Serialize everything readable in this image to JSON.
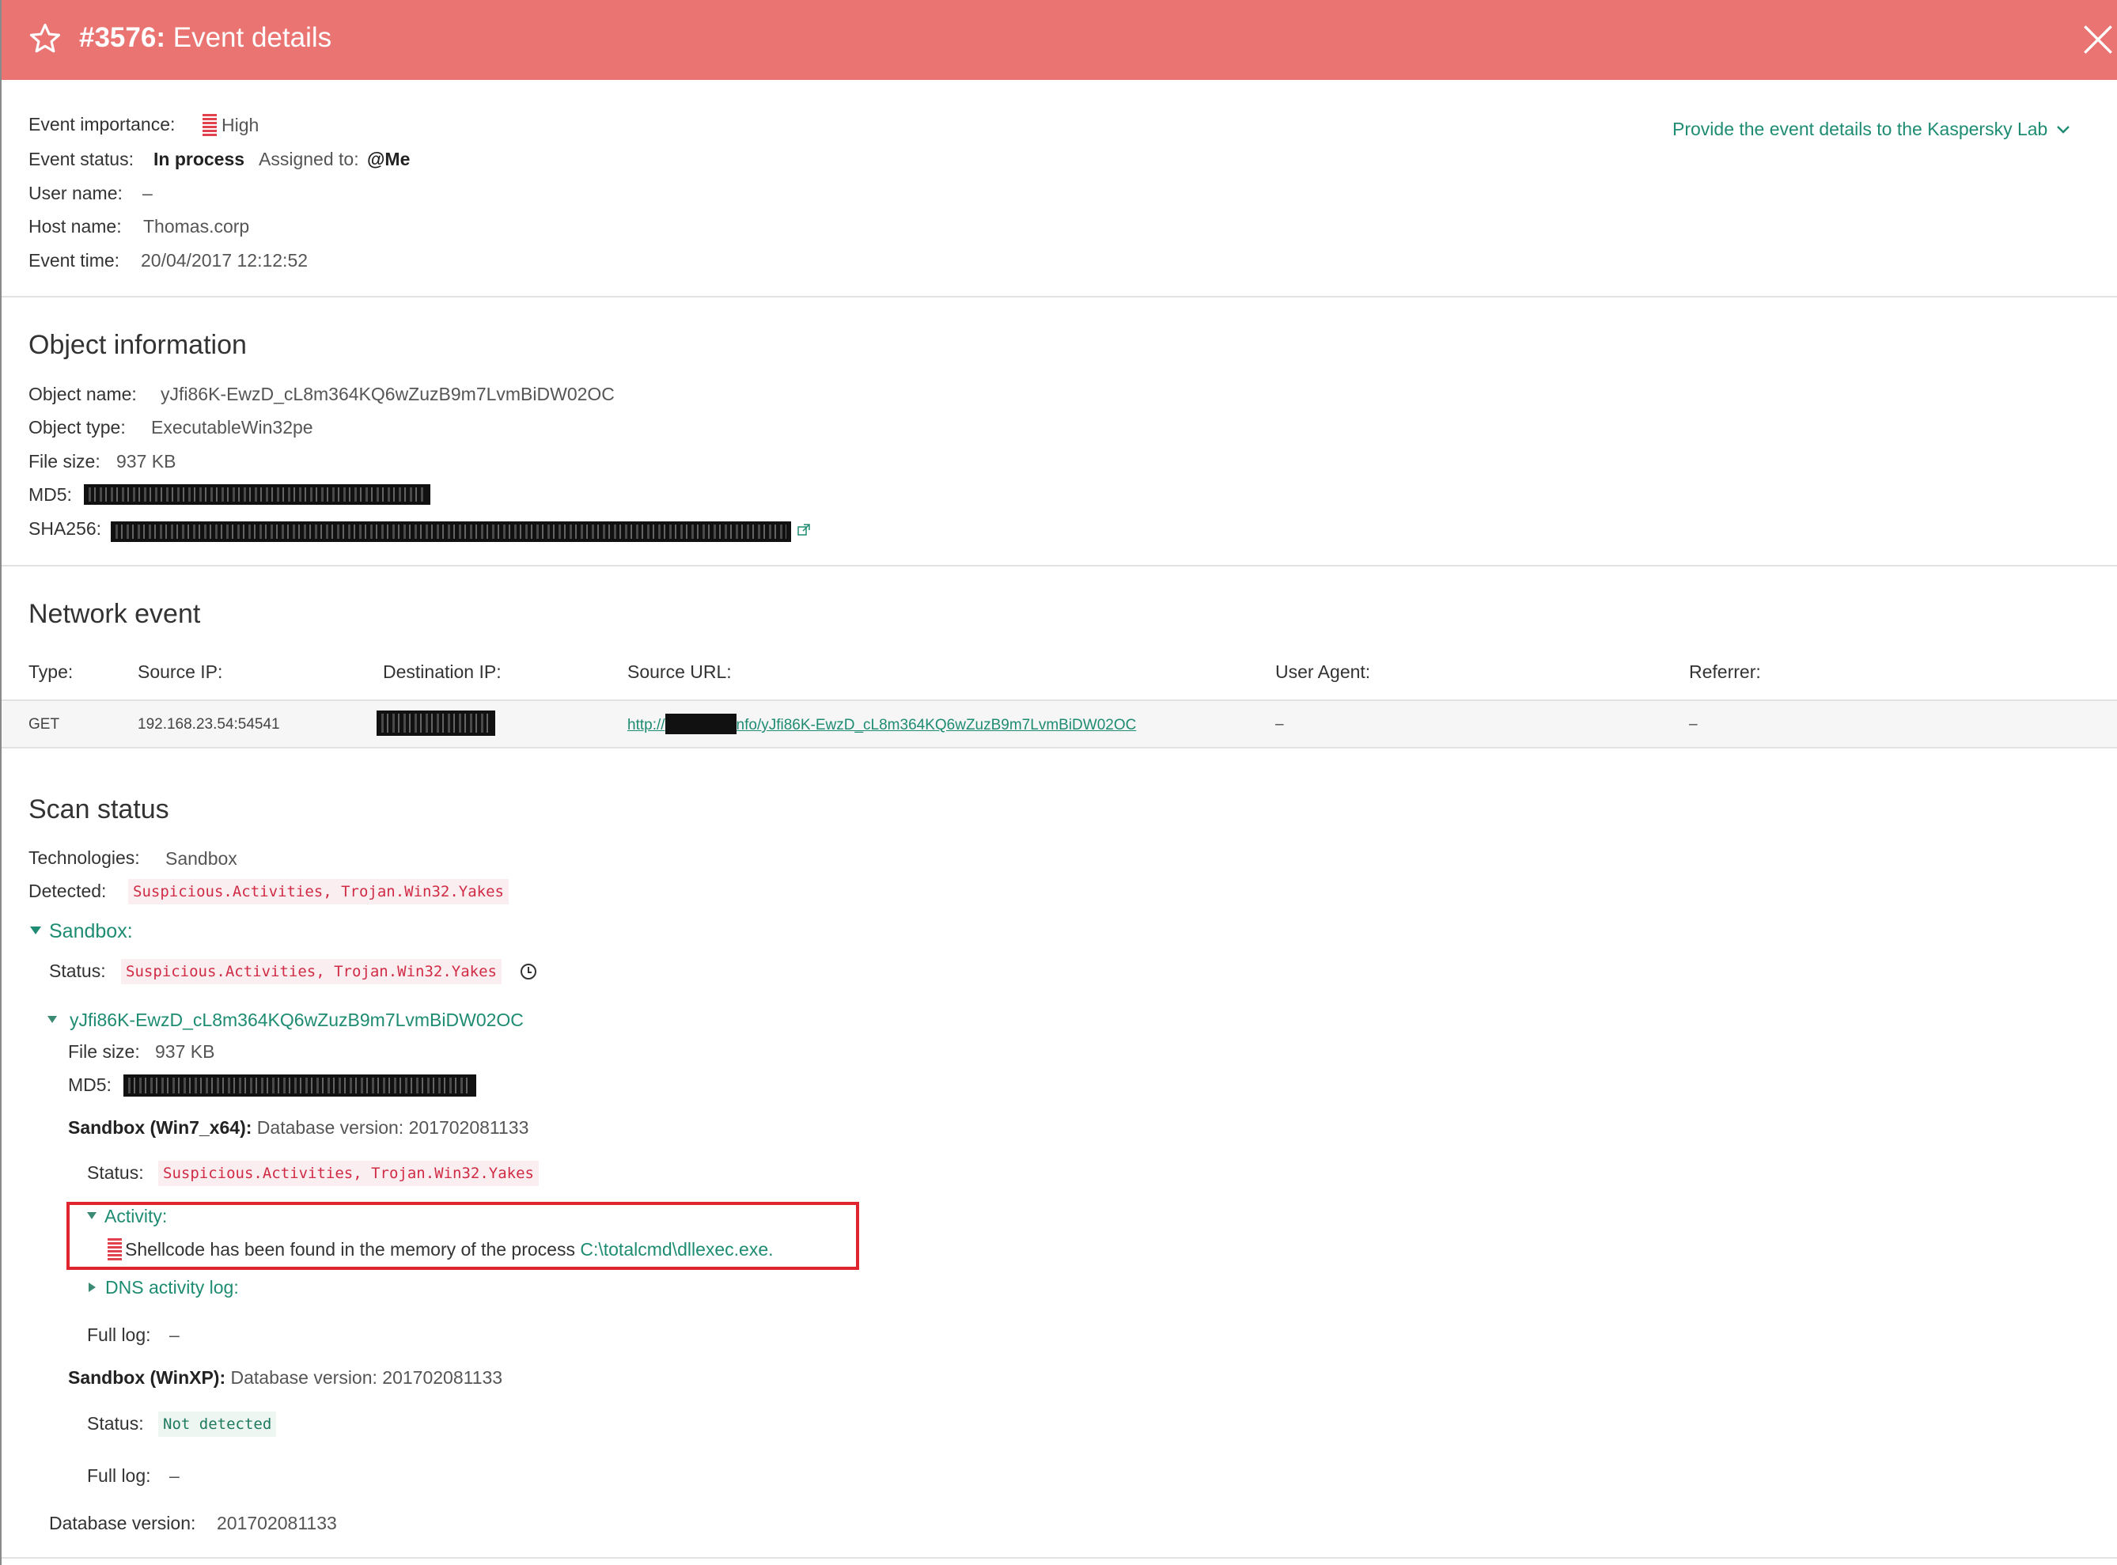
{
  "header": {
    "event_number": "#3576:",
    "title": "Event details",
    "star_icon": "star-outline-icon",
    "close_icon": "close-icon",
    "background_color": "#e97472"
  },
  "event": {
    "importance_label": "Event importance:",
    "importance_value": "High",
    "status_label": "Event status:",
    "status_value": "In process",
    "assigned_label": "Assigned to:",
    "assigned_value": "@Me",
    "user_label": "User name:",
    "user_value": "–",
    "host_label": "Host name:",
    "host_value": "Thomas.corp",
    "time_label": "Event time:",
    "time_value": "20/04/2017 12:12:52",
    "provide_link": "Provide the event details to the Kaspersky Lab"
  },
  "object_info": {
    "heading": "Object information",
    "name_label": "Object name:",
    "name_value": "yJfi86K-EwzD_cL8m364KQ6wZuzB9m7LvmBiDW02OC",
    "type_label": "Object type:",
    "type_value": "ExecutableWin32pe",
    "size_label": "File size:",
    "size_value": "937 KB",
    "md5_label": "MD5:",
    "sha_label": "SHA256:"
  },
  "network": {
    "heading": "Network event",
    "columns": [
      "Type:",
      "Source IP:",
      "Destination IP:",
      "Source URL:",
      "User Agent:",
      "Referrer:"
    ],
    "row": {
      "type": "GET",
      "source_ip": "192.168.23.54:54541",
      "url_prefix": "http://",
      "url_suffix": "nfo/yJfi86K-EwzD_cL8m364KQ6wZuzB9m7LvmBiDW02OC",
      "user_agent": "–",
      "referrer": "–"
    }
  },
  "scan": {
    "heading": "Scan status",
    "tech_label": "Technologies:",
    "tech_value": "Sandbox",
    "detected_label": "Detected:",
    "detected_value": "Suspicious.Activities, Trojan.Win32.Yakes",
    "sandbox_label": "Sandbox:",
    "sandbox_status_label": "Status:",
    "sandbox_status_value": "Suspicious.Activities, Trojan.Win32.Yakes",
    "file_name": "yJfi86K-EwzD_cL8m364KQ6wZuzB9m7LvmBiDW02OC",
    "file_size_label": "File size:",
    "file_size_value": "937 KB",
    "file_md5_label": "MD5:",
    "win7_title": "Sandbox (Win7_x64):",
    "win7_db": "Database version: 201702081133",
    "win7_status_label": "Status:",
    "win7_status_value": "Suspicious.Activities, Trojan.Win32.Yakes",
    "activity_label": "Activity:",
    "activity_text": "Shellcode has been found in the memory of the process",
    "activity_path": "C:\\totalcmd\\dllexec.exe.",
    "dns_label": "DNS activity log:",
    "win7_fulllog_label": "Full log:",
    "win7_fulllog_value": "–",
    "winxp_title": "Sandbox (WinXP):",
    "winxp_db": "Database version: 201702081133",
    "winxp_status_label": "Status:",
    "winxp_status_value": "Not detected",
    "winxp_fulllog_label": "Full log:",
    "winxp_fulllog_value": "–",
    "db_label": "Database version:",
    "db_value": "201702081133"
  },
  "colors": {
    "accent_green": "#1e8c72",
    "danger_red": "#d02b45",
    "highlight_border": "#e0242e"
  }
}
